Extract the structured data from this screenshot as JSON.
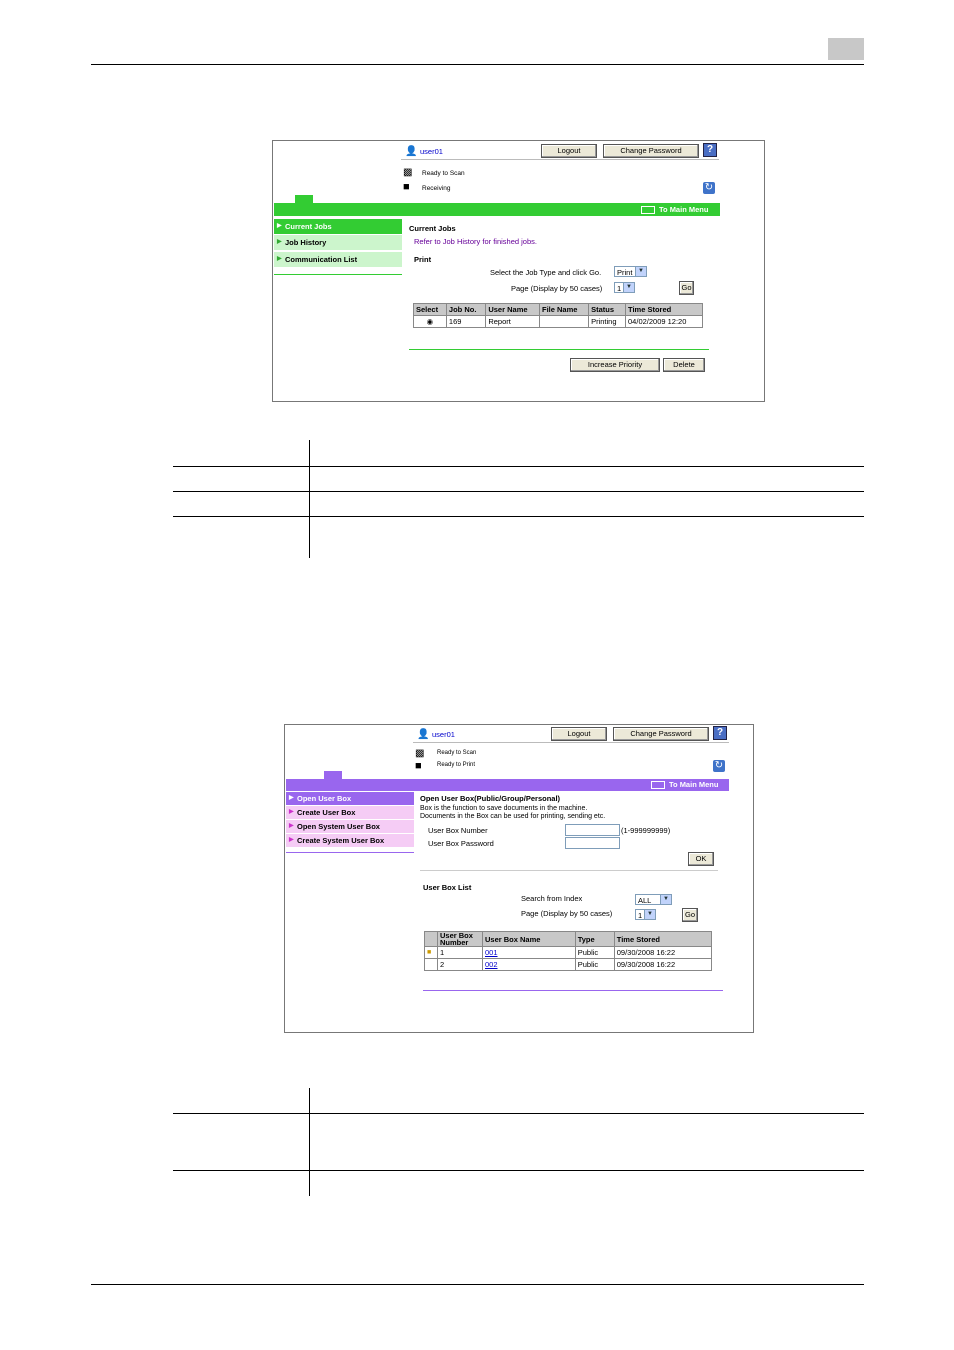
{
  "screen1": {
    "user": "user01",
    "logout": "Logout",
    "change_password": "Change Password",
    "status1": "Ready to Scan",
    "status2": "Receiving",
    "main_menu": "To Main Menu",
    "accent": "#33cc33",
    "nav": [
      {
        "label": "Current Jobs"
      },
      {
        "label": "Job History"
      },
      {
        "label": "Communication List"
      }
    ],
    "heading": "Current Jobs",
    "refer_text": "Refer to Job History for finished jobs.",
    "section": "Print",
    "select_type_label": "Select the Job Type and click Go.",
    "select_type_value": "Print",
    "page_label": "Page (Display by 50 cases)",
    "page_value": "1",
    "go": "Go",
    "table_headers": [
      "Select",
      "Job No.",
      "User Name",
      "File Name",
      "Status",
      "Time Stored"
    ],
    "table_rows": [
      {
        "job_no": "169",
        "user_name": "Report",
        "file_name": "",
        "status": "Printing",
        "time": "04/02/2009 12:20"
      }
    ],
    "increase_priority": "Increase Priority",
    "delete": "Delete"
  },
  "screen2": {
    "user": "user01",
    "logout": "Logout",
    "change_password": "Change Password",
    "status1": "Ready to Scan",
    "status2": "Ready to Print",
    "main_menu": "To Main Menu",
    "accent": "#9966ee",
    "nav": [
      {
        "label": "Open User Box"
      },
      {
        "label": "Create User Box"
      },
      {
        "label": "Open System User Box"
      },
      {
        "label": "Create System User Box"
      }
    ],
    "heading": "Open User Box(Public/Group/Personal)",
    "desc1": "Box is the function to save documents in the machine.",
    "desc2": "Documents in the Box can be used for printing, sending etc.",
    "box_number_label": "User Box Number",
    "box_number_range": "(1-999999999)",
    "box_password_label": "User Box Password",
    "ok": "OK",
    "list_heading": "User Box List",
    "search_label": "Search from Index",
    "search_value": "ALL",
    "page_label": "Page (Display by 50 cases)",
    "page_value": "1",
    "go": "Go",
    "table_headers": [
      "User Box Number",
      "User Box Name",
      "Type",
      "Time Stored"
    ],
    "table_rows": [
      {
        "number": "1",
        "name": "001",
        "type": "Public",
        "time": "09/30/2008 16:22"
      },
      {
        "number": "2",
        "name": "002",
        "type": "Public",
        "time": "09/30/2008 16:22"
      }
    ]
  }
}
